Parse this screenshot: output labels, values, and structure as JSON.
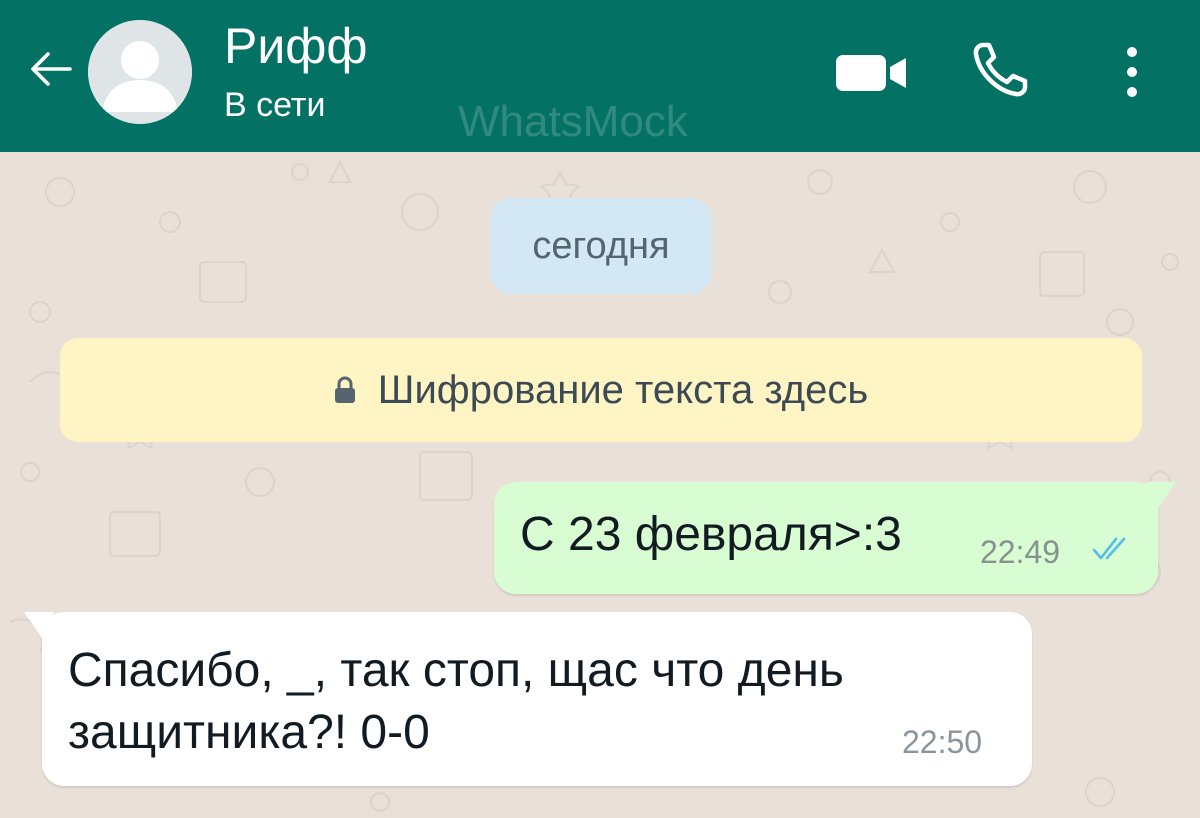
{
  "header": {
    "contact_name": "Рифф",
    "status": "В сети",
    "watermark": "WhatsMock",
    "icons": {
      "back": "arrow-left-icon",
      "avatar": "default-avatar-icon",
      "video": "video-call-icon",
      "call": "phone-icon",
      "menu": "more-vertical-icon"
    }
  },
  "chat": {
    "date_label": "сегодня",
    "encryption_note": "Шифрование текста здесь",
    "messages": [
      {
        "direction": "outgoing",
        "text": "С 23 февраля>:3",
        "time": "22:49",
        "status": "read"
      },
      {
        "direction": "incoming",
        "text": "Спасибо, _, так стоп, щас что день защитника?! 0-0",
        "time": "22:50"
      }
    ]
  },
  "colors": {
    "header_bg": "#047165",
    "chat_bg": "#e9e0d7",
    "outgoing_bubble": "#d9fdd3",
    "incoming_bubble": "#ffffff",
    "date_chip": "#d4e7f4",
    "system_note": "#fff4c4",
    "read_ticks": "#53bdeb"
  }
}
